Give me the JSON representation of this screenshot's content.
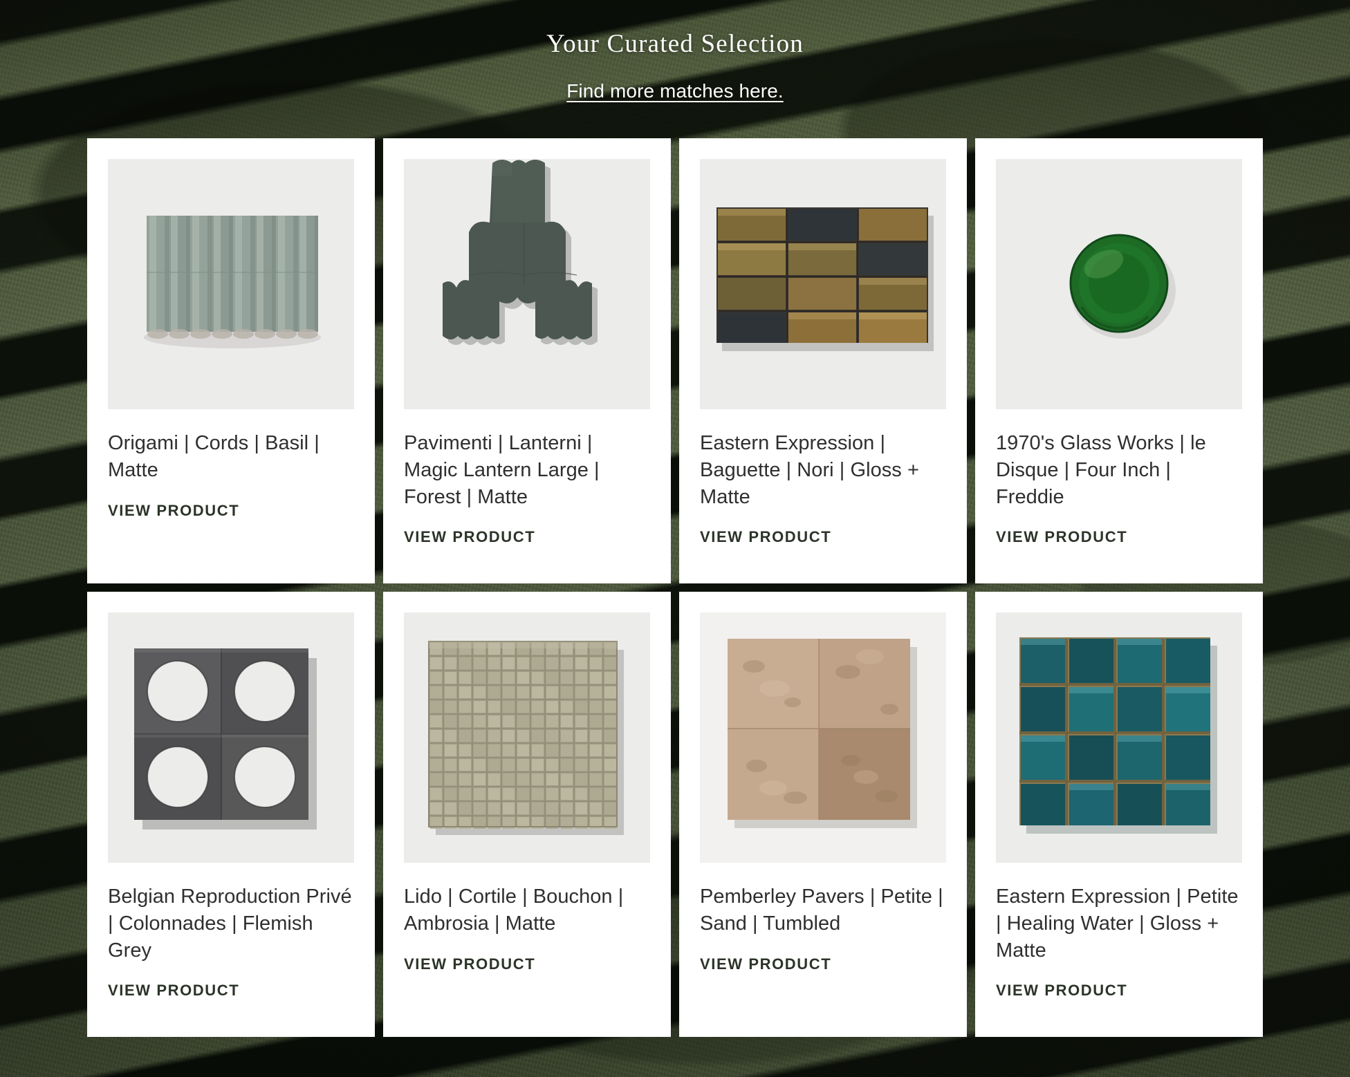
{
  "header": {
    "title": "Your Curated Selection",
    "subtitle_link": "Find more matches here."
  },
  "colors": {
    "card_background": "#ffffff",
    "media_background": "#ececeb",
    "title_text": "#ffffff",
    "product_title_text": "#2f2f2f",
    "view_product_text": "#2c3429",
    "page_background": "#2e3a26"
  },
  "common": {
    "view_product_label": "VIEW PRODUCT"
  },
  "products": [
    {
      "title": "Origami | Cords | Basil | Matte",
      "cta": "VIEW PRODUCT",
      "image_name": "fluted-basil-green-tile-photo",
      "swatch": "#8fa097"
    },
    {
      "title": "Pavimenti | Lanterni | Magic Lantern Large | Forest | Matte",
      "cta": "VIEW PRODUCT",
      "image_name": "magic-lantern-forest-green-tile-photo",
      "swatch": "#4c584d"
    },
    {
      "title": "Eastern Expression | Baguette | Nori | Gloss + Matte",
      "cta": "VIEW PRODUCT",
      "image_name": "baguette-nori-brick-tile-photo",
      "swatch": "#7a6436"
    },
    {
      "title": "1970's Glass Works | le Disque | Four Inch | Freddie",
      "cta": "VIEW PRODUCT",
      "image_name": "le-disque-green-glass-round-tile-photo",
      "swatch": "#1f6b28"
    },
    {
      "title": "Belgian Reproduction Privé | Colonnades | Flemish Grey",
      "cta": "VIEW PRODUCT",
      "image_name": "colonnades-flemish-grey-stone-tile-photo",
      "swatch": "#58585a"
    },
    {
      "title": "Lido | Cortile | Bouchon | Ambrosia | Matte",
      "cta": "VIEW PRODUCT",
      "image_name": "cortile-ambrosia-mosaic-tile-photo",
      "swatch": "#b0ad95"
    },
    {
      "title": "Pemberley Pavers | Petite | Sand | Tumbled",
      "cta": "VIEW PRODUCT",
      "image_name": "pemberley-pavers-sand-tumbled-stone-photo",
      "swatch": "#c0a186"
    },
    {
      "title": "Eastern Expression | Petite | Healing Water | Gloss + Matte",
      "cta": "VIEW PRODUCT",
      "image_name": "petite-healing-water-teal-tile-photo",
      "swatch": "#1d5a63"
    }
  ]
}
